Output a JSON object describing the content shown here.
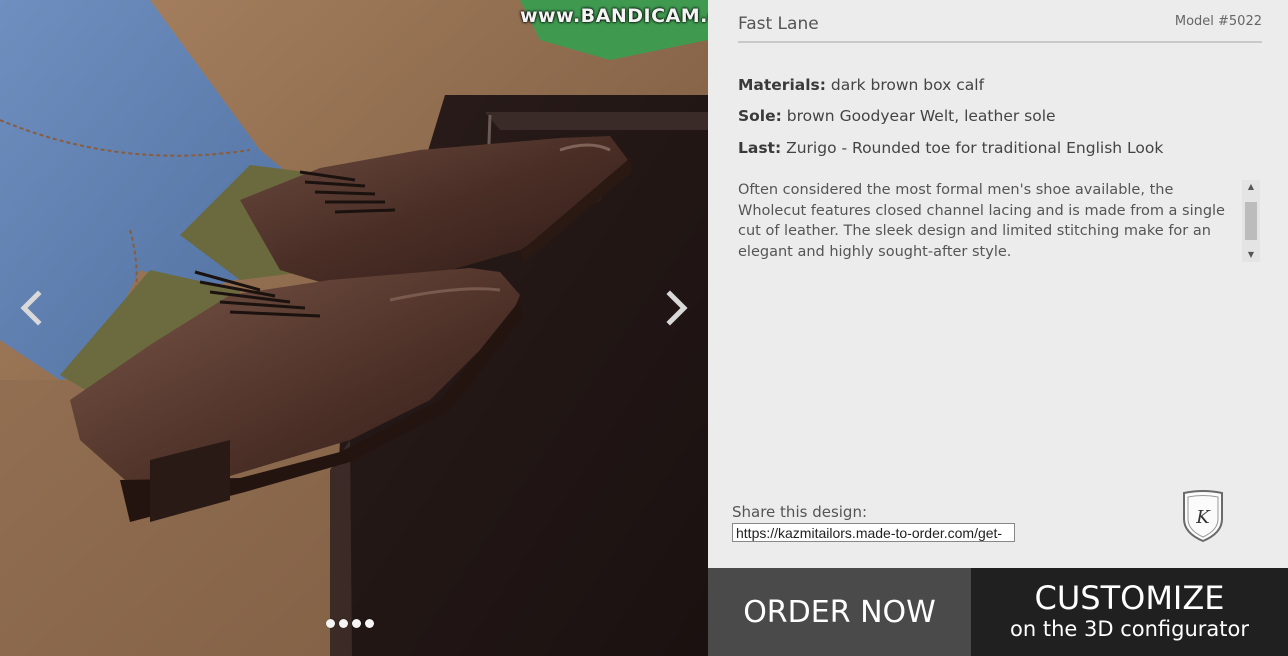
{
  "watermark": "www.BANDICAM.com",
  "product": {
    "title": "Fast Lane",
    "model": "Model #5022",
    "specs": [
      {
        "label": "Materials:",
        "value": "dark brown box calf"
      },
      {
        "label": "Sole:",
        "value": "brown Goodyear Welt, leather sole"
      },
      {
        "label": "Last:",
        "value": "Zurigo - Rounded toe for traditional English Look"
      }
    ],
    "description": "Often considered the most formal men's shoe available, the Wholecut features closed channel lacing and is made from a single cut of leather. The sleek design and limited stitching make for an elegant and highly sought-after style."
  },
  "share": {
    "label": "Share this design:",
    "url": "https://kazmitailors.made-to-order.com/get-"
  },
  "logo": {
    "letter": "K",
    "icon": "shield-logo-icon"
  },
  "carousel": {
    "prev_icon": "chevron-left-icon",
    "next_icon": "chevron-right-icon",
    "slides": 4
  },
  "buttons": {
    "order": "ORDER NOW",
    "customize": "CUSTOMIZE",
    "customize_sub": "on the 3D configurator"
  },
  "colors": {
    "order_bg": "#4a4a4a",
    "customize_bg": "#202020",
    "panel_bg": "#ececec"
  }
}
